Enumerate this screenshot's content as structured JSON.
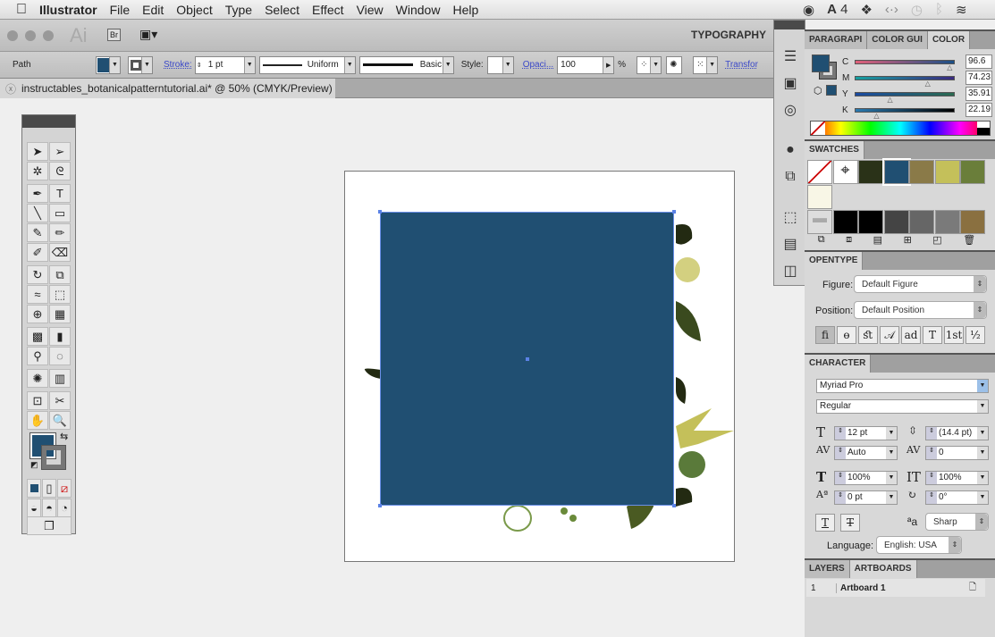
{
  "menubar": {
    "app": "Illustrator",
    "items": [
      "File",
      "Edit",
      "Object",
      "Type",
      "Select",
      "Effect",
      "View",
      "Window",
      "Help"
    ],
    "status": {
      "adobe_count": "4"
    }
  },
  "appbar": {
    "logo": "Ai",
    "bridge": "Br",
    "workspace": "TYPOGRAPHY"
  },
  "control": {
    "selection": "Path",
    "stroke_label": "Stroke:",
    "stroke_value": "1 pt",
    "profile": "Uniform",
    "brush": "Basic",
    "style_label": "Style:",
    "opacity_label": "Opaci...",
    "opacity_value": "100",
    "percent": "%",
    "transform_label": "Transfor",
    "fill_color": "#204f72"
  },
  "document": {
    "tab_title": "instructables_botanicalpatterntutorial.ai* @ 50% (CMYK/Preview)"
  },
  "tools": [
    {
      "name": "selection",
      "g": "➤"
    },
    {
      "name": "direct-selection",
      "g": "➢"
    },
    {
      "name": "magic-wand",
      "g": "✲"
    },
    {
      "name": "lasso",
      "g": "ᘓ"
    },
    {
      "name": "pen",
      "g": "✒"
    },
    {
      "name": "type",
      "g": "T"
    },
    {
      "name": "line-segment",
      "g": "╲"
    },
    {
      "name": "rectangle",
      "g": "▭"
    },
    {
      "name": "paintbrush",
      "g": "✎"
    },
    {
      "name": "pencil",
      "g": "✏"
    },
    {
      "name": "blob-brush",
      "g": "✐"
    },
    {
      "name": "eraser",
      "g": "⌫"
    },
    {
      "name": "rotate",
      "g": "↻"
    },
    {
      "name": "scale",
      "g": "⧉"
    },
    {
      "name": "warp",
      "g": "≈"
    },
    {
      "name": "free-transform",
      "g": "⬚"
    },
    {
      "name": "shape-builder",
      "g": "⊕"
    },
    {
      "name": "perspective-grid",
      "g": "▦"
    },
    {
      "name": "mesh",
      "g": "▩"
    },
    {
      "name": "gradient",
      "g": "▮"
    },
    {
      "name": "eyedropper",
      "g": "⚲"
    },
    {
      "name": "blend",
      "g": "◌"
    },
    {
      "name": "symbol-sprayer",
      "g": "✺"
    },
    {
      "name": "column-graph",
      "g": "▥"
    },
    {
      "name": "artboard",
      "g": "⊡"
    },
    {
      "name": "slice",
      "g": "✂"
    },
    {
      "name": "hand",
      "g": "✋"
    },
    {
      "name": "zoom",
      "g": "🔍"
    }
  ],
  "color_panel": {
    "tabs": [
      "PARAGRAPI",
      "COLOR GUI",
      "COLOR"
    ],
    "channels": [
      {
        "label": "C",
        "value": "96.6",
        "pct": 96.6,
        "grad": "linear-gradient(90deg,#e0607a,#1a4f86)"
      },
      {
        "label": "M",
        "value": "74.23",
        "pct": 74.23,
        "grad": "linear-gradient(90deg,#16a0a0,#3a2a80)"
      },
      {
        "label": "Y",
        "value": "35.91",
        "pct": 35.91,
        "grad": "linear-gradient(90deg,#1a4aa0,#2a6a50)"
      },
      {
        "label": "K",
        "value": "22.19",
        "pct": 22.19,
        "grad": "linear-gradient(90deg,#2a7ab0,#000)"
      }
    ],
    "percent": "%",
    "fill": "#204f72"
  },
  "swatches": {
    "title": "SWATCHES",
    "row1": [
      "none",
      "registration",
      "#2a3218",
      "#204f72",
      "#8a7a48",
      "#c4c05a",
      "#6a7e3a"
    ],
    "row2": [
      "#f8f6e6"
    ],
    "row3": [
      "folder",
      "#000000",
      "#000000",
      "#444444",
      "#666666",
      "#7a7a7a",
      "#8a7040"
    ]
  },
  "opentype": {
    "title": "OPENTYPE",
    "figure_label": "Figure:",
    "figure_value": "Default Figure",
    "position_label": "Position:",
    "position_value": "Default Position",
    "buttons": [
      "ﬁ",
      "ɵ",
      "ﬆ",
      "𝒜",
      "ad",
      "T",
      "1st",
      "½"
    ]
  },
  "character": {
    "title": "CHARACTER",
    "font": "Myriad Pro",
    "style": "Regular",
    "size": "12 pt",
    "leading": "(14.4 pt)",
    "kerning": "Auto",
    "tracking": "0",
    "vscale": "100%",
    "hscale": "100%",
    "baseline": "0 pt",
    "rotation": "0°",
    "antialias": "Sharp",
    "language_label": "Language:",
    "language": "English: USA"
  },
  "layers": {
    "tabs": [
      "LAYERS",
      "ARTBOARDS"
    ],
    "rows": [
      {
        "num": "1",
        "name": "Artboard 1"
      }
    ]
  }
}
